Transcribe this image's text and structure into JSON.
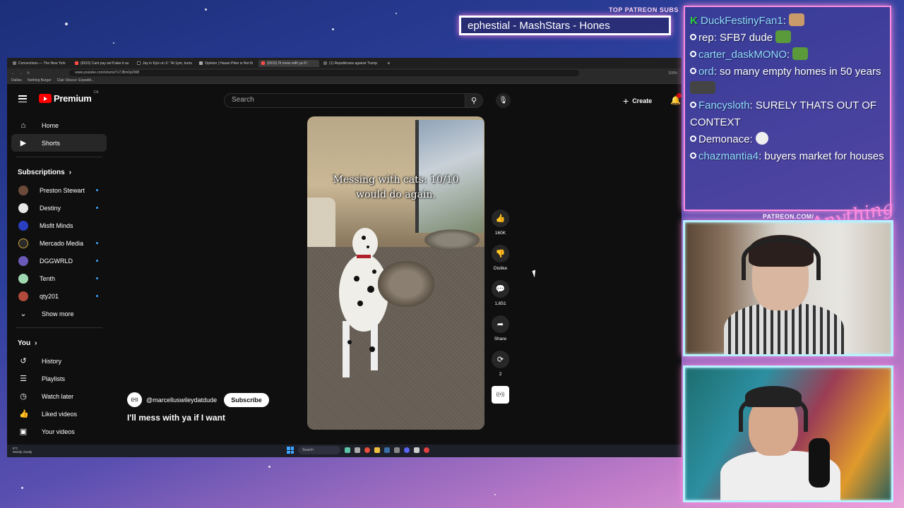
{
  "overlay": {
    "top_patreon_label": "TOP PATREON SUBS",
    "sub_ticker": "ephestial - MashStars - Hones",
    "patreon_url": "PATREON.COM/",
    "brand_script": "Anything Else?"
  },
  "browser": {
    "tabs": [
      {
        "title": "Connections — The New York"
      },
      {
        "title": "(6515) Cant pay we'll take it as"
      },
      {
        "title": "Jay in Kyiv on X: \"At 1pm, turns"
      },
      {
        "title": "Opinion | Hasan Piker is Not th"
      },
      {
        "title": "(6515) I'll mess with ya if I"
      },
      {
        "title": "(1) Republicans against Trump"
      }
    ],
    "url": "www.youtube.com/shorts/7v7JBm0p2W8",
    "zoom": "150%",
    "bookmarks": [
      "Dailies",
      "Nothing Burger",
      "Clair Obscur: Expediti..."
    ]
  },
  "youtube": {
    "logo_text": "Premium",
    "logo_region": "CA",
    "search_placeholder": "Search",
    "create_label": "Create",
    "nav": [
      {
        "label": "Home",
        "icon": "home-icon"
      },
      {
        "label": "Shorts",
        "icon": "shorts-icon"
      }
    ],
    "subscriptions_heading": "Subscriptions",
    "subscriptions": [
      {
        "name": "Preston Stewart",
        "color": "#6b4a3a"
      },
      {
        "name": "Destiny",
        "color": "#e8e8e8"
      },
      {
        "name": "Misfit Minds",
        "color": "#2a3fbf"
      },
      {
        "name": "Mercado Media",
        "color": "#2a2a2a"
      },
      {
        "name": "DGGWRLD",
        "color": "#6b5ab8"
      },
      {
        "name": "Tenth",
        "color": "#9fd8b0"
      },
      {
        "name": "qty201",
        "color": "#b04a3a"
      }
    ],
    "show_more": "Show more",
    "you_heading": "You",
    "you_items": [
      {
        "label": "History",
        "icon": "history-icon"
      },
      {
        "label": "Playlists",
        "icon": "playlists-icon"
      },
      {
        "label": "Watch later",
        "icon": "clock-icon"
      },
      {
        "label": "Liked videos",
        "icon": "thumbs-up-icon"
      },
      {
        "label": "Your videos",
        "icon": "play-square-icon"
      }
    ],
    "short": {
      "caption": "Messing with cats: 10/10 would do again.",
      "channel": "@marcelluswileydatdude",
      "subscribe_label": "Subscribe",
      "title": "I'll mess with ya if I want",
      "likes": "160K",
      "dislike_label": "Dislike",
      "comments": "1,651",
      "share_label": "Share",
      "remix_count": "2"
    }
  },
  "taskbar": {
    "weather": "6°C\nMostly cloudy",
    "search_label": "Search"
  },
  "chat": {
    "messages": [
      {
        "user": "DuckFestinyFan1",
        "text": ""
      },
      {
        "user": "rep",
        "text": "SFB7 dude"
      },
      {
        "user": "carter_daskMONO",
        "text": ""
      },
      {
        "user": "ord",
        "text": "so many empty homes in 50 years"
      },
      {
        "user": "Fancysloth",
        "text": "SURELY THATS OUT OF CONTEXT"
      },
      {
        "user": "Demonace",
        "text": ""
      },
      {
        "user": "chazmantia4",
        "text": "buyers market for houses"
      }
    ]
  }
}
